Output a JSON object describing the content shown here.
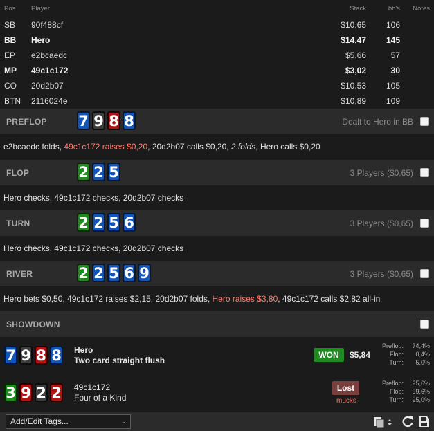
{
  "columns": {
    "pos": "Pos",
    "player": "Player",
    "stack": "Stack",
    "bbs": "bb's",
    "notes": "Notes"
  },
  "players": [
    {
      "pos": "SB",
      "name": "90f488cf",
      "stack": "$10,65",
      "bbs": "106"
    },
    {
      "pos": "BB",
      "name": "Hero",
      "stack": "$14,47",
      "bbs": "145"
    },
    {
      "pos": "EP",
      "name": "e2bcaedc",
      "stack": "$5,66",
      "bbs": "57"
    },
    {
      "pos": "MP",
      "name": "49c1c172",
      "stack": "$3,02",
      "bbs": "30"
    },
    {
      "pos": "CO",
      "name": "20d2b07",
      "stack": "$10,53",
      "bbs": "105"
    },
    {
      "pos": "BTN",
      "name": "2116024e",
      "stack": "$10,89",
      "bbs": "109"
    }
  ],
  "streets": {
    "preflop": {
      "name": "PREFLOP",
      "cards": [
        {
          "v": "7",
          "s": "d"
        },
        {
          "v": "9",
          "s": "s"
        },
        {
          "v": "8",
          "s": "h"
        },
        {
          "v": "8",
          "s": "d"
        }
      ],
      "info": "Dealt to Hero in BB",
      "actions": [
        {
          "t": "e2bcaedc folds, "
        },
        {
          "t": "49c1c172 raises $0,20",
          "red": true
        },
        {
          "t": ", 20d2b07 calls $0,20, "
        },
        {
          "t": "2 folds",
          "it": true
        },
        {
          "t": ", Hero calls $0,20"
        }
      ]
    },
    "flop": {
      "name": "FLOP",
      "cards": [
        {
          "v": "2",
          "s": "c"
        },
        {
          "v": "2",
          "s": "d"
        },
        {
          "v": "5",
          "s": "d"
        }
      ],
      "info": "3 Players ($0,65)",
      "actions": [
        {
          "t": "Hero checks, 49c1c172 checks, 20d2b07 checks"
        }
      ]
    },
    "turn": {
      "name": "TURN",
      "cards": [
        {
          "v": "2",
          "s": "c"
        },
        {
          "v": "2",
          "s": "d"
        },
        {
          "v": "5",
          "s": "d"
        },
        {
          "v": "6",
          "s": "d"
        }
      ],
      "info": "3 Players ($0,65)",
      "actions": [
        {
          "t": "Hero checks, 49c1c172 checks, 20d2b07 checks"
        }
      ]
    },
    "river": {
      "name": "RIVER",
      "cards": [
        {
          "v": "2",
          "s": "c"
        },
        {
          "v": "2",
          "s": "d"
        },
        {
          "v": "5",
          "s": "d"
        },
        {
          "v": "6",
          "s": "d"
        },
        {
          "v": "9",
          "s": "d"
        }
      ],
      "info": "3 Players ($0,65)",
      "actions": [
        {
          "t": "Hero bets $0,50, 49c1c172 raises $2,15, 20d2b07 folds, "
        },
        {
          "t": "Hero raises $3,80",
          "red": true
        },
        {
          "t": ", 49c1c172 calls $2,82 all-in"
        }
      ]
    }
  },
  "showdown": {
    "name": "SHOWDOWN",
    "hands": [
      {
        "player": "Hero",
        "hand": "Two card straight flush",
        "cards": [
          {
            "v": "7",
            "s": "d"
          },
          {
            "v": "9",
            "s": "s"
          },
          {
            "v": "8",
            "s": "h"
          },
          {
            "v": "8",
            "s": "d"
          }
        ],
        "result": "WON",
        "amount": "$5,84",
        "equity": [
          {
            "l": "Preflop:",
            "v": "74,4%"
          },
          {
            "l": "Flop:",
            "v": "0,4%"
          },
          {
            "l": "Turn:",
            "v": "5,0%"
          }
        ]
      },
      {
        "player": "49c1c172",
        "hand": "Four of a Kind",
        "cards": [
          {
            "v": "3",
            "s": "c"
          },
          {
            "v": "9",
            "s": "h"
          },
          {
            "v": "2",
            "s": "s"
          },
          {
            "v": "2",
            "s": "h"
          }
        ],
        "result": "Lost",
        "sub": "mucks",
        "equity": [
          {
            "l": "Preflop:",
            "v": "25,6%"
          },
          {
            "l": "Flop:",
            "v": "99,6%"
          },
          {
            "l": "Turn:",
            "v": "95,0%"
          }
        ]
      }
    ]
  },
  "bottom": {
    "tags_label": "Add/Edit Tags..."
  },
  "colors": {
    "spade": "#3d3d3d",
    "heart": "#b01515",
    "diamond": "#1155b8",
    "club": "#1f8b1f",
    "won": "#1f8a1f",
    "lost": "#7a3f3f",
    "raise": "#ff7b6b"
  },
  "icons": [
    "copy-icon",
    "refresh-icon",
    "save-icon",
    "chevron-down-icon",
    "checkbox-icon"
  ]
}
